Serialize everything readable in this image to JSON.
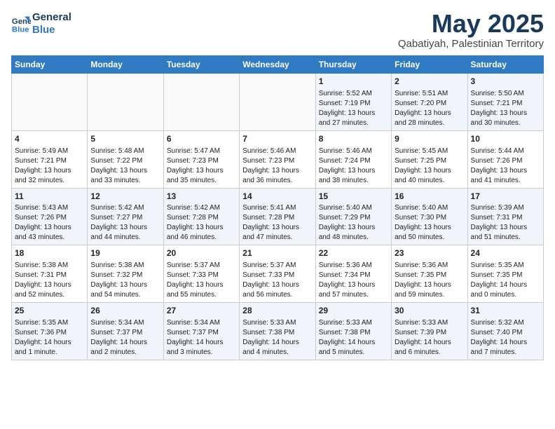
{
  "logo": {
    "line1": "General",
    "line2": "Blue"
  },
  "title": "May 2025",
  "subtitle": "Qabatiyah, Palestinian Territory",
  "days_of_week": [
    "Sunday",
    "Monday",
    "Tuesday",
    "Wednesday",
    "Thursday",
    "Friday",
    "Saturday"
  ],
  "weeks": [
    [
      {
        "day": "",
        "content": ""
      },
      {
        "day": "",
        "content": ""
      },
      {
        "day": "",
        "content": ""
      },
      {
        "day": "",
        "content": ""
      },
      {
        "day": "1",
        "content": "Sunrise: 5:52 AM\nSunset: 7:19 PM\nDaylight: 13 hours\nand 27 minutes."
      },
      {
        "day": "2",
        "content": "Sunrise: 5:51 AM\nSunset: 7:20 PM\nDaylight: 13 hours\nand 28 minutes."
      },
      {
        "day": "3",
        "content": "Sunrise: 5:50 AM\nSunset: 7:21 PM\nDaylight: 13 hours\nand 30 minutes."
      }
    ],
    [
      {
        "day": "4",
        "content": "Sunrise: 5:49 AM\nSunset: 7:21 PM\nDaylight: 13 hours\nand 32 minutes."
      },
      {
        "day": "5",
        "content": "Sunrise: 5:48 AM\nSunset: 7:22 PM\nDaylight: 13 hours\nand 33 minutes."
      },
      {
        "day": "6",
        "content": "Sunrise: 5:47 AM\nSunset: 7:23 PM\nDaylight: 13 hours\nand 35 minutes."
      },
      {
        "day": "7",
        "content": "Sunrise: 5:46 AM\nSunset: 7:23 PM\nDaylight: 13 hours\nand 36 minutes."
      },
      {
        "day": "8",
        "content": "Sunrise: 5:46 AM\nSunset: 7:24 PM\nDaylight: 13 hours\nand 38 minutes."
      },
      {
        "day": "9",
        "content": "Sunrise: 5:45 AM\nSunset: 7:25 PM\nDaylight: 13 hours\nand 40 minutes."
      },
      {
        "day": "10",
        "content": "Sunrise: 5:44 AM\nSunset: 7:26 PM\nDaylight: 13 hours\nand 41 minutes."
      }
    ],
    [
      {
        "day": "11",
        "content": "Sunrise: 5:43 AM\nSunset: 7:26 PM\nDaylight: 13 hours\nand 43 minutes."
      },
      {
        "day": "12",
        "content": "Sunrise: 5:42 AM\nSunset: 7:27 PM\nDaylight: 13 hours\nand 44 minutes."
      },
      {
        "day": "13",
        "content": "Sunrise: 5:42 AM\nSunset: 7:28 PM\nDaylight: 13 hours\nand 46 minutes."
      },
      {
        "day": "14",
        "content": "Sunrise: 5:41 AM\nSunset: 7:28 PM\nDaylight: 13 hours\nand 47 minutes."
      },
      {
        "day": "15",
        "content": "Sunrise: 5:40 AM\nSunset: 7:29 PM\nDaylight: 13 hours\nand 48 minutes."
      },
      {
        "day": "16",
        "content": "Sunrise: 5:40 AM\nSunset: 7:30 PM\nDaylight: 13 hours\nand 50 minutes."
      },
      {
        "day": "17",
        "content": "Sunrise: 5:39 AM\nSunset: 7:31 PM\nDaylight: 13 hours\nand 51 minutes."
      }
    ],
    [
      {
        "day": "18",
        "content": "Sunrise: 5:38 AM\nSunset: 7:31 PM\nDaylight: 13 hours\nand 52 minutes."
      },
      {
        "day": "19",
        "content": "Sunrise: 5:38 AM\nSunset: 7:32 PM\nDaylight: 13 hours\nand 54 minutes."
      },
      {
        "day": "20",
        "content": "Sunrise: 5:37 AM\nSunset: 7:33 PM\nDaylight: 13 hours\nand 55 minutes."
      },
      {
        "day": "21",
        "content": "Sunrise: 5:37 AM\nSunset: 7:33 PM\nDaylight: 13 hours\nand 56 minutes."
      },
      {
        "day": "22",
        "content": "Sunrise: 5:36 AM\nSunset: 7:34 PM\nDaylight: 13 hours\nand 57 minutes."
      },
      {
        "day": "23",
        "content": "Sunrise: 5:36 AM\nSunset: 7:35 PM\nDaylight: 13 hours\nand 59 minutes."
      },
      {
        "day": "24",
        "content": "Sunrise: 5:35 AM\nSunset: 7:35 PM\nDaylight: 14 hours\nand 0 minutes."
      }
    ],
    [
      {
        "day": "25",
        "content": "Sunrise: 5:35 AM\nSunset: 7:36 PM\nDaylight: 14 hours\nand 1 minute."
      },
      {
        "day": "26",
        "content": "Sunrise: 5:34 AM\nSunset: 7:37 PM\nDaylight: 14 hours\nand 2 minutes."
      },
      {
        "day": "27",
        "content": "Sunrise: 5:34 AM\nSunset: 7:37 PM\nDaylight: 14 hours\nand 3 minutes."
      },
      {
        "day": "28",
        "content": "Sunrise: 5:33 AM\nSunset: 7:38 PM\nDaylight: 14 hours\nand 4 minutes."
      },
      {
        "day": "29",
        "content": "Sunrise: 5:33 AM\nSunset: 7:38 PM\nDaylight: 14 hours\nand 5 minutes."
      },
      {
        "day": "30",
        "content": "Sunrise: 5:33 AM\nSunset: 7:39 PM\nDaylight: 14 hours\nand 6 minutes."
      },
      {
        "day": "31",
        "content": "Sunrise: 5:32 AM\nSunset: 7:40 PM\nDaylight: 14 hours\nand 7 minutes."
      }
    ]
  ]
}
